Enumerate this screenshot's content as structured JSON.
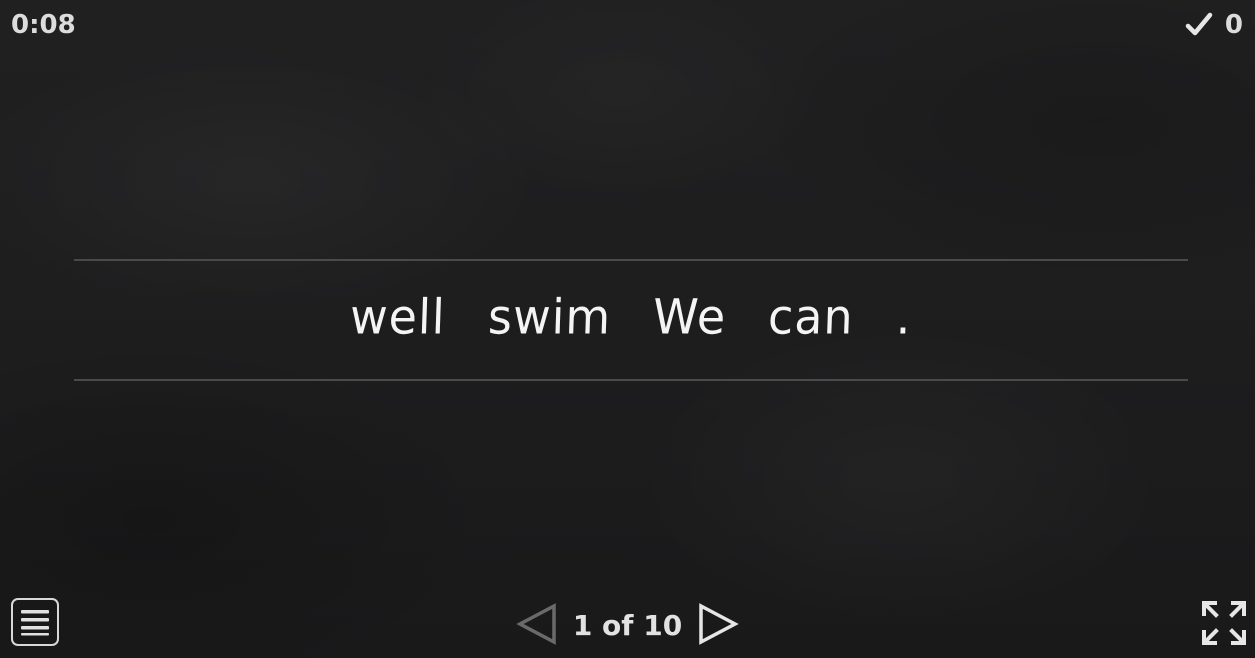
{
  "hud": {
    "timer": "0:08",
    "score": "0"
  },
  "sentence": {
    "words": [
      "well",
      "swim",
      "We",
      "can",
      "."
    ]
  },
  "pager": {
    "label": "1 of 10"
  },
  "icons": {
    "score": "checkmark-icon",
    "menu": "hamburger-menu-icon",
    "previous": "triangle-left-icon",
    "next": "triangle-right-icon",
    "fullscreen": "fullscreen-icon"
  },
  "colors": {
    "background": "#1e1e1f",
    "text": "#f4f4f4",
    "rule": "#4a4a4b",
    "disabled_nav": "#6a6a6a"
  }
}
